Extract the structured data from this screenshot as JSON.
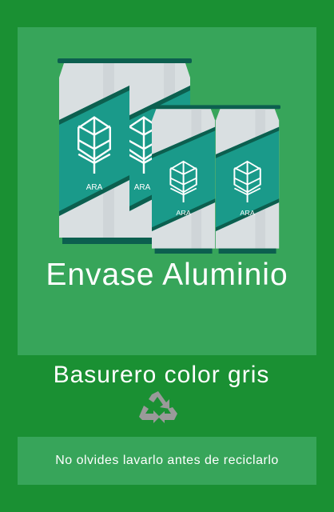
{
  "poster": {
    "title": "Envase Aluminio",
    "bin_instruction": "Basurero color gris",
    "reminder": "No olvides lavarlo antes de reciclarlo",
    "can_brand": "ARA",
    "icons": [
      "aluminum-cans-illustration",
      "leaf-logo-icon",
      "recycle-icon"
    ],
    "colors": {
      "background": "#1a9033",
      "panel": "#37a55a",
      "can_body": "#d9dfe1",
      "can_label": "#1a9a8a",
      "can_stripe": "#0c5f4f",
      "recycle_icon": "#9a9a9a"
    }
  }
}
